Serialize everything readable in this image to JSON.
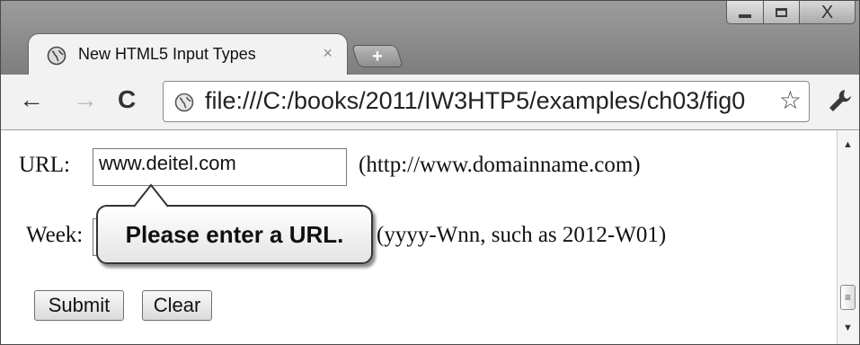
{
  "window": {
    "controls": {
      "minimize": "minimize",
      "maximize": "maximize",
      "close": "X"
    }
  },
  "tab": {
    "title": "New HTML5 Input Types",
    "close": "×",
    "new_tab": "+"
  },
  "toolbar": {
    "url": "file:///C:/books/2011/IW3HTP5/examples/ch03/fig0"
  },
  "form": {
    "url_label": "URL:",
    "url_value": "www.deitel.com",
    "url_hint": "(http://www.domainname.com)",
    "week_label": "Week:",
    "week_hint": "(yyyy-Wnn, such as 2012-W01)",
    "submit_label": "Submit",
    "clear_label": "Clear"
  },
  "validation": {
    "message": "Please enter a URL."
  },
  "icons": {
    "back": "back-arrow-icon",
    "forward": "forward-arrow-icon",
    "reload": "reload-icon",
    "page": "globe-icon",
    "bookmark": "star-icon",
    "settings": "wrench-icon"
  }
}
